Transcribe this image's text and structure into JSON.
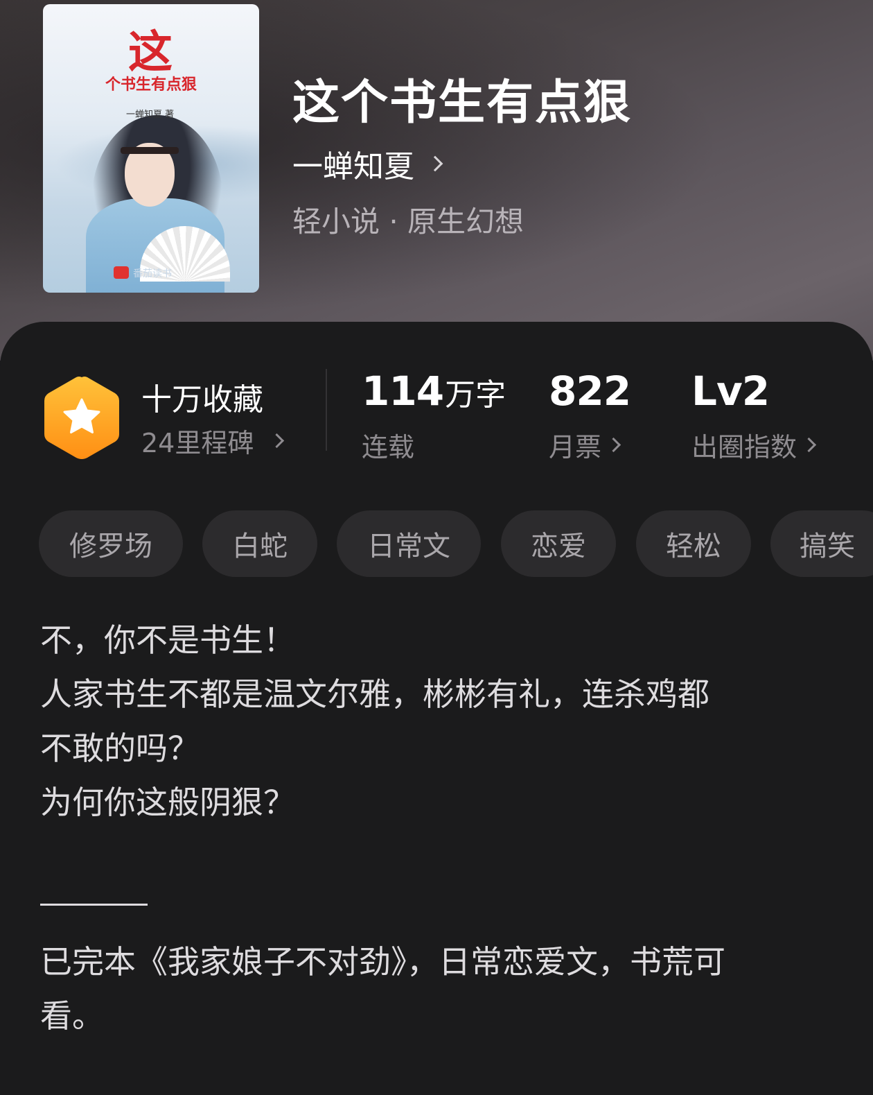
{
  "cover": {
    "big_char": "这",
    "subtitle": "个书生有点狠",
    "author_line": "一蝉知夏 著",
    "publisher": "番茄读书"
  },
  "book": {
    "title": "这个书生有点狠",
    "author": "一蝉知夏",
    "category": "轻小说 · 原生幻想"
  },
  "stats": {
    "favorites": {
      "label": "十万收藏",
      "sub": "24里程碑"
    },
    "words": {
      "value": "114",
      "unit": "万字",
      "sub": "连载"
    },
    "monthly_votes": {
      "value": "822",
      "sub": "月票"
    },
    "breakout_index": {
      "value": "Lv2",
      "sub": "出圈指数"
    }
  },
  "tags": [
    "修罗场",
    "白蛇",
    "日常文",
    "恋爱",
    "轻松",
    "搞笑"
  ],
  "synopsis": {
    "lines": [
      "不，你不是书生！",
      "人家书生不都是温文尔雅，彬彬有礼，连杀鸡都",
      "不敢的吗？",
      "为何你这般阴狠？"
    ],
    "note_lines": [
      "已完本《我家娘子不对劲》，日常恋爱文，书荒可",
      "看。"
    ]
  },
  "colors": {
    "badge_orange": "#ffaa1e",
    "card_bg": "#1b1b1c",
    "tag_bg": "#2c2b2d",
    "cover_red": "#d8262c"
  }
}
